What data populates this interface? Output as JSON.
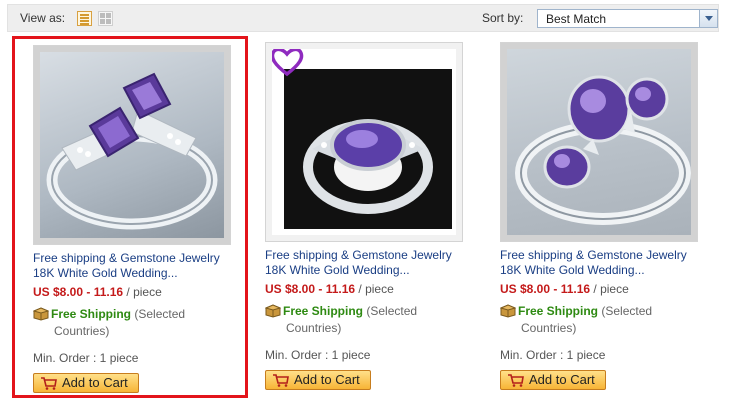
{
  "toolbar": {
    "view_as_label": "View as:",
    "sort_by_label": "Sort by:",
    "sort_selected": "Best Match"
  },
  "products": [
    {
      "title_line1": "Free shipping & Gemstone Jewelry",
      "title_line2": "18K White Gold Wedding...",
      "price": "US $8.00 - 11.16",
      "unit": "/ piece",
      "free_shipping": "Free Shipping",
      "selected_a": "(Selected",
      "selected_b": "Countries)",
      "min_order": "Min. Order : 1 piece",
      "add_to_cart": "Add to Cart"
    },
    {
      "title_line1": "Free shipping & Gemstone Jewelry",
      "title_line2": "18K White Gold Wedding...",
      "price": "US $8.00 - 11.16",
      "unit": "/ piece",
      "free_shipping": "Free Shipping",
      "selected_a": "(Selected",
      "selected_b": "Countries)",
      "min_order": "Min. Order : 1 piece",
      "add_to_cart": "Add to Cart"
    },
    {
      "title_line1": "Free shipping & Gemstone Jewelry",
      "title_line2": "18K White Gold Wedding...",
      "price": "US $8.00 - 11.16",
      "unit": "/ piece",
      "free_shipping": "Free Shipping",
      "selected_a": "(Selected",
      "selected_b": "Countries)",
      "min_order": "Min. Order : 1 piece",
      "add_to_cart": "Add to Cart"
    }
  ],
  "colors": {
    "selection_border": "#e3141b",
    "title_link": "#1a3e84",
    "price": "#c41a1a",
    "free_shipping": "#2e8a12",
    "gem": "#6a3fb0"
  },
  "icons": [
    "list-view-icon",
    "grid-view-icon",
    "dropdown-arrow-icon",
    "shipping-box-icon",
    "cart-icon",
    "heart-icon"
  ]
}
